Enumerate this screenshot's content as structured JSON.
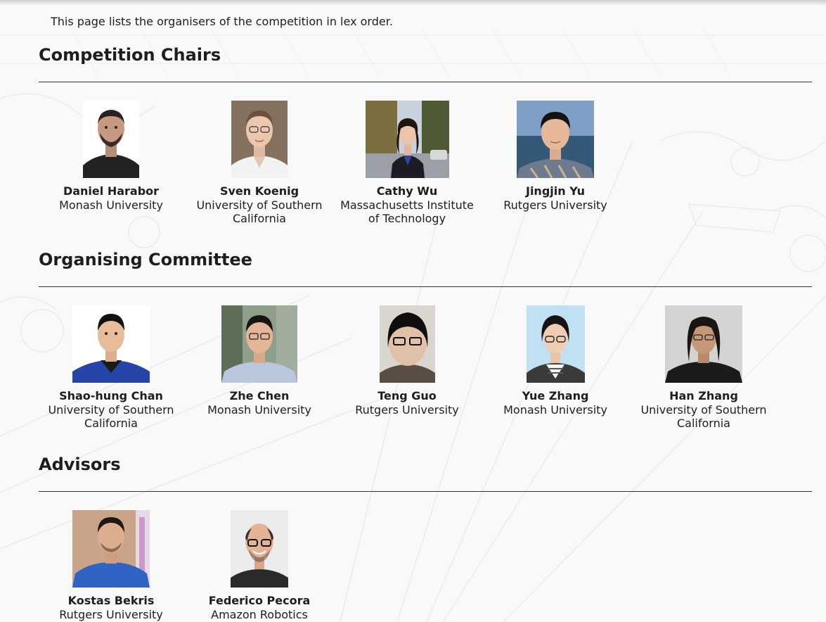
{
  "intro": "This page lists the organisers of the competition in lex order.",
  "sections": [
    {
      "title": "Competition Chairs",
      "people": [
        {
          "name": "Daniel Harabor",
          "affiliation": "Monash University"
        },
        {
          "name": "Sven Koenig",
          "affiliation": "University of Southern California"
        },
        {
          "name": "Cathy Wu",
          "affiliation": "Massachusetts Institute of Technology"
        },
        {
          "name": "Jingjin Yu",
          "affiliation": "Rutgers University"
        }
      ]
    },
    {
      "title": "Organising Committee",
      "people": [
        {
          "name": "Shao-hung Chan",
          "affiliation": "University of Southern California"
        },
        {
          "name": "Zhe Chen",
          "affiliation": "Monash University"
        },
        {
          "name": "Teng Guo",
          "affiliation": "Rutgers University"
        },
        {
          "name": "Yue Zhang",
          "affiliation": "Monash University"
        },
        {
          "name": "Han Zhang",
          "affiliation": "University of Southern California"
        }
      ]
    },
    {
      "title": "Advisors",
      "people": [
        {
          "name": "Kostas Bekris",
          "affiliation": "Rutgers University"
        },
        {
          "name": "Federico Pecora",
          "affiliation": "Amazon Robotics"
        }
      ]
    }
  ],
  "colors": {
    "background": "#f9f9f9",
    "text": "#1e1e1e",
    "rule": "#333333"
  }
}
